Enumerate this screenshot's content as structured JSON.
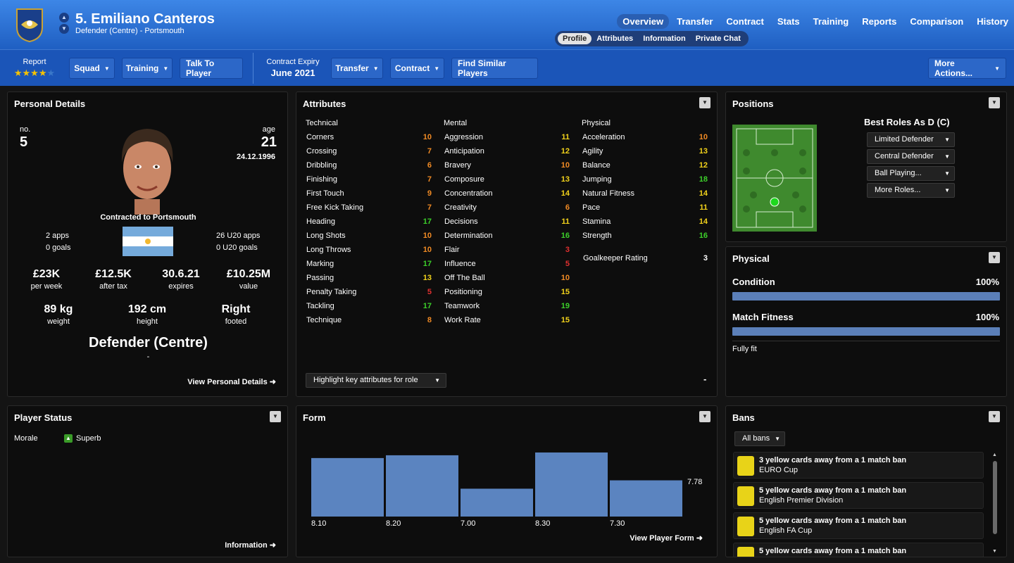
{
  "header": {
    "name": "5. Emiliano Canteros",
    "subtitle": "Defender (Centre) - Portsmouth",
    "tabs": [
      "Overview",
      "Transfer",
      "Contract",
      "Stats",
      "Training",
      "Reports",
      "Comparison",
      "History"
    ],
    "subtabs": [
      "Profile",
      "Attributes",
      "Information",
      "Private Chat"
    ]
  },
  "toolbar": {
    "report_label": "Report",
    "stars": 4,
    "squad": "Squad",
    "training": "Training",
    "talk": "Talk To Player",
    "contract_expiry_label": "Contract Expiry",
    "contract_expiry_value": "June 2021",
    "transfer": "Transfer",
    "contract": "Contract",
    "find_similar": "Find Similar Players",
    "more_actions": "More Actions..."
  },
  "personal": {
    "title": "Personal Details",
    "no_label": "no.",
    "no_value": "5",
    "age_label": "age",
    "age_value": "21",
    "dob": "24.12.1996",
    "contracted": "Contracted to Portsmouth",
    "apps": "2 apps",
    "goals": "0 goals",
    "u20_apps": "26 U20 apps",
    "u20_goals": "0 U20 goals",
    "wage": "£23K",
    "wage_lbl": "per week",
    "aftertax": "£12.5K",
    "aftertax_lbl": "after tax",
    "expires": "30.6.21",
    "expires_lbl": "expires",
    "value": "£10.25M",
    "value_lbl": "value",
    "weight": "89 kg",
    "weight_lbl": "weight",
    "height": "192 cm",
    "height_lbl": "height",
    "foot": "Right",
    "foot_lbl": "footed",
    "position": "Defender (Centre)",
    "position_sub": "-",
    "link": "View Personal Details"
  },
  "attributes": {
    "title": "Attributes",
    "technical_hdr": "Technical",
    "mental_hdr": "Mental",
    "physical_hdr": "Physical",
    "technical": [
      [
        "Corners",
        10
      ],
      [
        "Crossing",
        7
      ],
      [
        "Dribbling",
        6
      ],
      [
        "Finishing",
        7
      ],
      [
        "First Touch",
        9
      ],
      [
        "Free Kick Taking",
        7
      ],
      [
        "Heading",
        17
      ],
      [
        "Long Shots",
        10
      ],
      [
        "Long Throws",
        10
      ],
      [
        "Marking",
        17
      ],
      [
        "Passing",
        13
      ],
      [
        "Penalty Taking",
        5
      ],
      [
        "Tackling",
        17
      ],
      [
        "Technique",
        8
      ]
    ],
    "mental": [
      [
        "Aggression",
        11
      ],
      [
        "Anticipation",
        12
      ],
      [
        "Bravery",
        10
      ],
      [
        "Composure",
        13
      ],
      [
        "Concentration",
        14
      ],
      [
        "Creativity",
        6
      ],
      [
        "Decisions",
        11
      ],
      [
        "Determination",
        16
      ],
      [
        "Flair",
        3
      ],
      [
        "Influence",
        5
      ],
      [
        "Off The Ball",
        10
      ],
      [
        "Positioning",
        15
      ],
      [
        "Teamwork",
        19
      ],
      [
        "Work Rate",
        15
      ]
    ],
    "physical": [
      [
        "Acceleration",
        10
      ],
      [
        "Agility",
        13
      ],
      [
        "Balance",
        12
      ],
      [
        "Jumping",
        18
      ],
      [
        "Natural Fitness",
        14
      ],
      [
        "Pace",
        11
      ],
      [
        "Stamina",
        14
      ],
      [
        "Strength",
        16
      ]
    ],
    "gk_label": "Goalkeeper Rating",
    "gk_value": "3",
    "highlight": "Highlight key attributes for role",
    "dash": "-"
  },
  "positions": {
    "title": "Positions",
    "best_roles": "Best Roles As D (C)",
    "roles": [
      "Limited Defender",
      "Central Defender",
      "Ball Playing...",
      "More Roles..."
    ]
  },
  "physical": {
    "title": "Physical",
    "condition_lbl": "Condition",
    "condition_val": "100%",
    "condition": 1.0,
    "fitness_lbl": "Match Fitness",
    "fitness_val": "100%",
    "fitness": 1.0,
    "status": "Fully fit"
  },
  "status": {
    "title": "Player Status",
    "morale_lbl": "Morale",
    "morale_val": "Superb",
    "link": "Information"
  },
  "form": {
    "title": "Form",
    "avg": "7.78",
    "link": "View Player Form"
  },
  "chart_data": {
    "type": "bar",
    "categories": [
      "8.10",
      "8.20",
      "7.00",
      "8.30",
      "7.30"
    ],
    "values": [
      8.1,
      8.2,
      7.0,
      8.3,
      7.3
    ],
    "title": "Form"
  },
  "bans": {
    "title": "Bans",
    "filter": "All bans",
    "items": [
      {
        "text": "3 yellow cards away from a 1 match ban",
        "comp": "EURO Cup"
      },
      {
        "text": "5 yellow cards away from a 1 match ban",
        "comp": "English Premier Division"
      },
      {
        "text": "5 yellow cards away from a 1 match ban",
        "comp": "English FA Cup"
      },
      {
        "text": "5 yellow cards away from a 1 match ban",
        "comp": ""
      }
    ]
  },
  "colors": {
    "low": "#e03030",
    "mid": "#f08a24",
    "good": "#f2d21b",
    "high": "#3ccf2a",
    "accent": "#1f5fc2"
  }
}
